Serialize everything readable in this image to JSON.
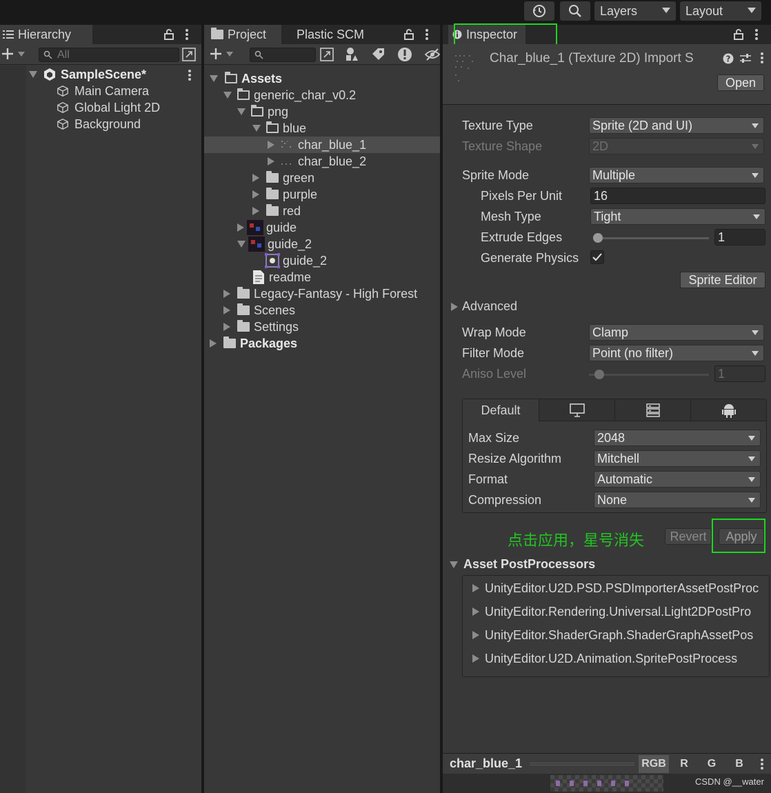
{
  "toolbar": {
    "history_icon": "history-icon",
    "search_icon": "search-icon",
    "layers_label": "Layers",
    "layout_label": "Layout"
  },
  "hierarchy": {
    "tab_label": "Hierarchy",
    "search_placeholder": "All",
    "scene_name": "SampleScene*",
    "objects": [
      "Main Camera",
      "Global Light 2D",
      "Background"
    ]
  },
  "project": {
    "tab_project": "Project",
    "tab_plastic": "Plastic SCM",
    "tree": {
      "assets": "Assets",
      "generic_char": "generic_char_v0.2",
      "png": "png",
      "blue": "blue",
      "char_blue_1": "char_blue_1",
      "char_blue_2": "char_blue_2",
      "green": "green",
      "purple": "purple",
      "red": "red",
      "guide": "guide",
      "guide_2": "guide_2",
      "guide_2_sprite": "guide_2",
      "readme": "readme",
      "legacy": "Legacy-Fantasy - High Forest",
      "scenes": "Scenes",
      "settings": "Settings",
      "packages": "Packages"
    }
  },
  "inspector": {
    "tab_label": "Inspector",
    "header_title": "Char_blue_1 (Texture 2D) Import S",
    "open_label": "Open",
    "texture_type_label": "Texture Type",
    "texture_type_value": "Sprite (2D and UI)",
    "texture_shape_label": "Texture Shape",
    "texture_shape_value": "2D",
    "sprite_mode_label": "Sprite Mode",
    "sprite_mode_value": "Multiple",
    "ppu_label": "Pixels Per Unit",
    "ppu_value": "16",
    "mesh_type_label": "Mesh Type",
    "mesh_type_value": "Tight",
    "extrude_label": "Extrude Edges",
    "extrude_value": "1",
    "gen_physics_label": "Generate Physics",
    "sprite_editor_label": "Sprite Editor",
    "advanced_label": "Advanced",
    "wrap_label": "Wrap Mode",
    "wrap_value": "Clamp",
    "filter_label": "Filter Mode",
    "filter_value": "Point (no filter)",
    "aniso_label": "Aniso Level",
    "aniso_value": "1",
    "platform_default": "Default",
    "max_size_label": "Max Size",
    "max_size_value": "2048",
    "resize_label": "Resize Algorithm",
    "resize_value": "Mitchell",
    "format_label": "Format",
    "format_value": "Automatic",
    "compression_label": "Compression",
    "compression_value": "None",
    "annotation": "点击应用，星号消失",
    "revert_label": "Revert",
    "apply_label": "Apply",
    "postprocessors_label": "Asset PostProcessors",
    "postprocessors": [
      "UnityEditor.U2D.PSD.PSDImporterAssetPostProc",
      "UnityEditor.Rendering.Universal.Light2DPostPro",
      "UnityEditor.ShaderGraph.ShaderGraphAssetPos",
      "UnityEditor.U2D.Animation.SpritePostProcess"
    ],
    "preview_name": "char_blue_1",
    "channels": [
      "RGB",
      "R",
      "G",
      "B"
    ],
    "watermark": "CSDN @__water"
  },
  "colors": {
    "selection": "#4d4d4d",
    "highlight_box": "#1fd51f",
    "annotation_text": "#22c322"
  }
}
